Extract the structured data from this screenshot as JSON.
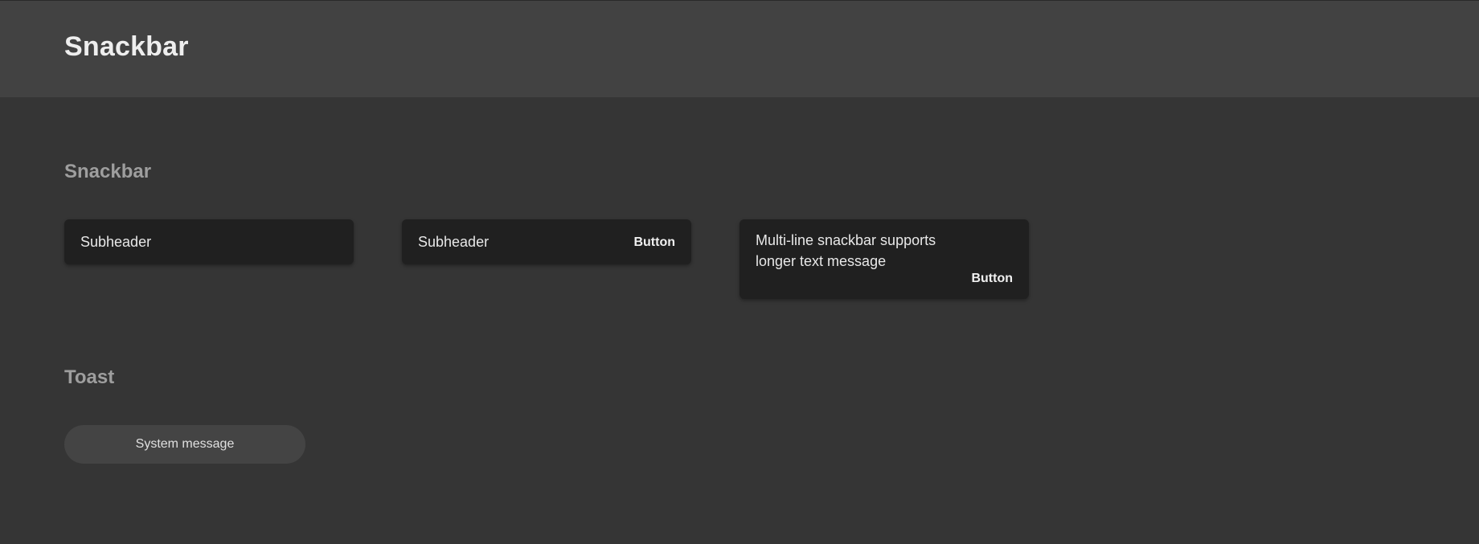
{
  "header": {
    "title": "Snackbar"
  },
  "sections": {
    "snackbar_title": "Snackbar",
    "toast_title": "Toast"
  },
  "snackbars": [
    {
      "text": "Subheader"
    },
    {
      "text": "Subheader",
      "button": "Button"
    },
    {
      "lines": [
        "Multi-line snackbar supports",
        "longer text message"
      ],
      "button": "Button"
    }
  ],
  "toast": {
    "text": "System message"
  },
  "colors": {
    "page_bg": "#353535",
    "header_bg": "#424242",
    "snackbar_bg": "#202020",
    "toast_bg": "#444444",
    "section_title": "#9e9e9e"
  }
}
